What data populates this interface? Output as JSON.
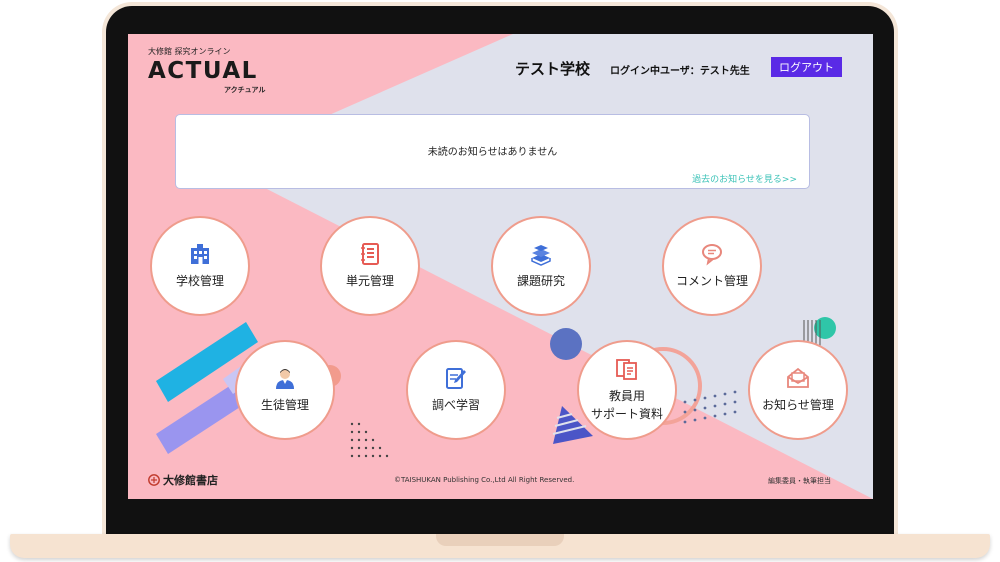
{
  "header": {
    "publisher_line": "大修館 探究オンライン",
    "logo_text": "ACTUAL",
    "logo_kana": "アクチュアル",
    "school_name": "テスト学校",
    "user_label": "ログイン中ユーザ：",
    "user_name": "テスト先生",
    "logout_label": "ログアウト"
  },
  "notice": {
    "message": "未読のお知らせはありません",
    "past_link": "過去のお知らせを見る>>"
  },
  "menu": {
    "school": "学校管理",
    "unit": "単元管理",
    "research": "課題研究",
    "comment": "コメント管理",
    "student": "生徒管理",
    "study": "調べ学習",
    "support_line1": "教員用",
    "support_line2": "サポート資料",
    "news": "お知らせ管理"
  },
  "footer": {
    "publisher": "大修館書店",
    "copyright": "©TAISHUKAN Publishing Co.,Ltd All Right Reserved.",
    "editors": "編集委員・執筆担当"
  },
  "colors": {
    "pink_bg": "#fbb9c2",
    "lavender_bg": "#dfe1ec",
    "circle_border": "#ef9c8c",
    "logout": "#5a2ae6",
    "link": "#3ec3b8",
    "icon_blue": "#3f6fd8",
    "icon_red": "#e65b54"
  }
}
